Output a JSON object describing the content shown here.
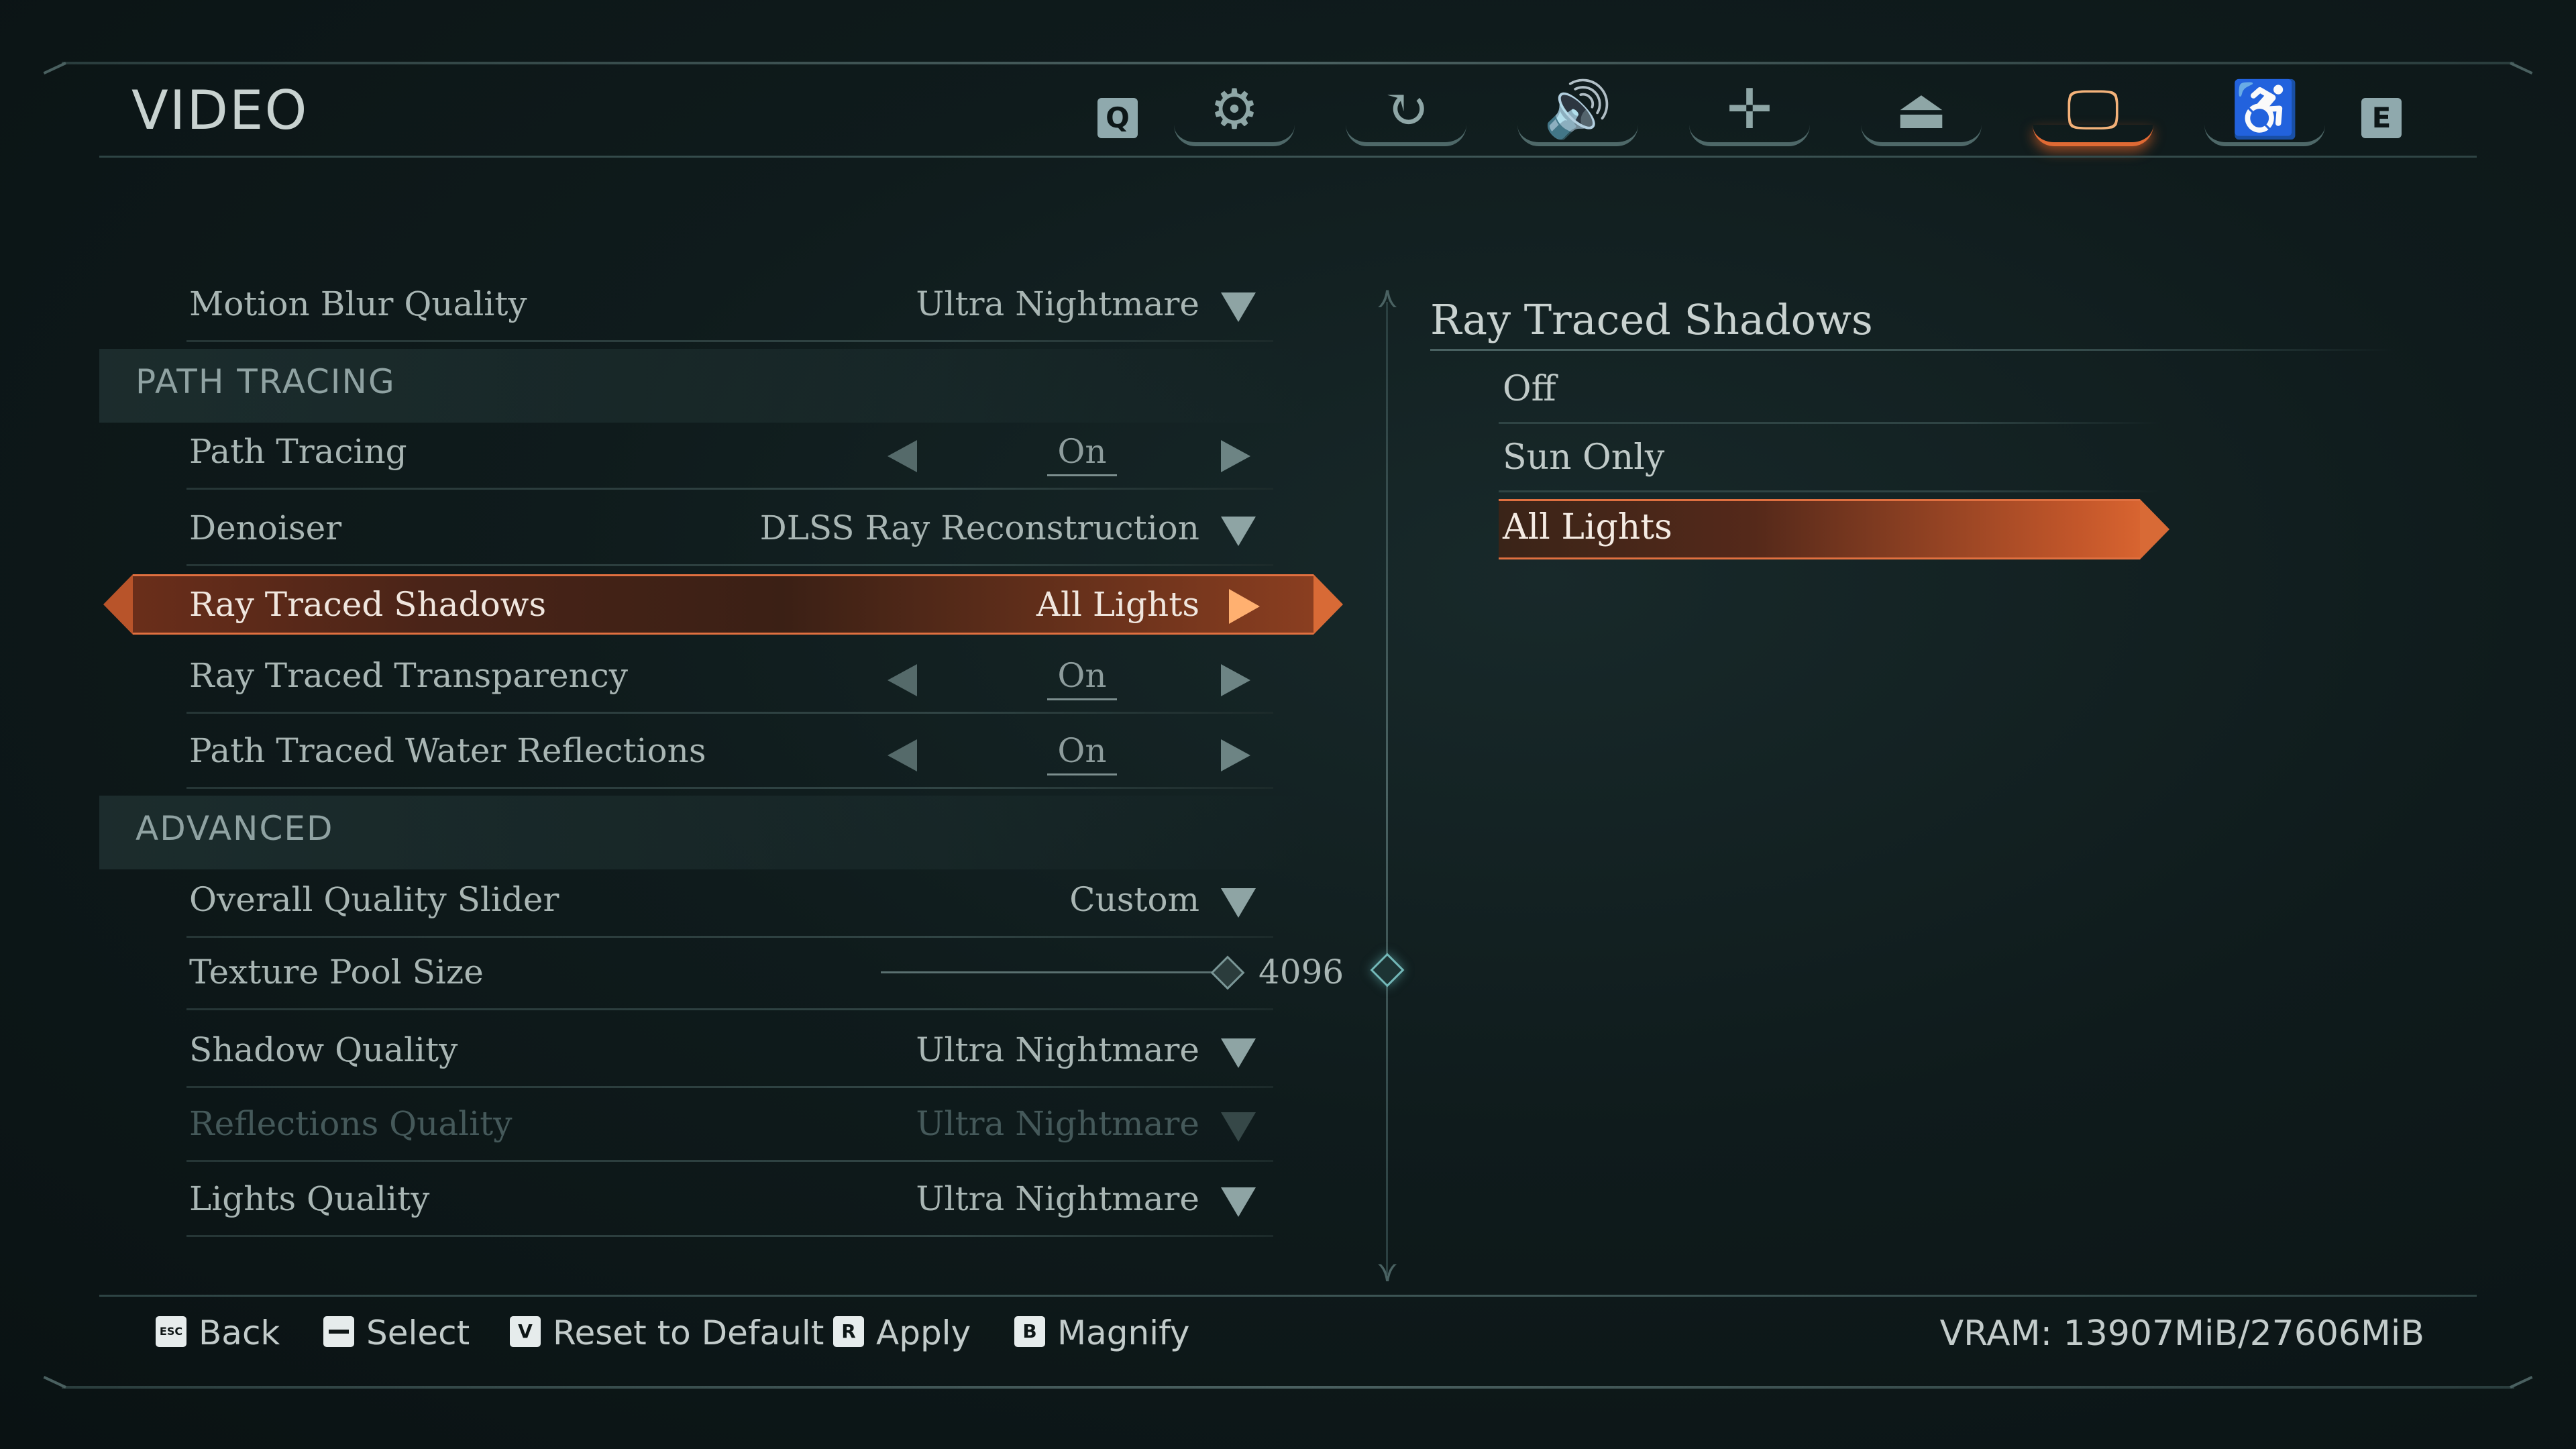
{
  "page": {
    "title": "VIDEO"
  },
  "tabs": {
    "prev_key": "Q",
    "next_key": "E",
    "items": [
      {
        "icon": "gears-icon",
        "glyph": "⚙",
        "active": false
      },
      {
        "icon": "refresh-icon",
        "glyph": "↻",
        "active": false
      },
      {
        "icon": "speaker-icon",
        "glyph": "🔊",
        "active": false
      },
      {
        "icon": "move-icon",
        "glyph": "✛",
        "active": false
      },
      {
        "icon": "joystick-icon",
        "glyph": "⏏",
        "active": false
      },
      {
        "icon": "monitor-icon",
        "glyph": "🖵",
        "active": true
      },
      {
        "icon": "accessibility-icon",
        "glyph": "♿",
        "active": false
      }
    ]
  },
  "settings": {
    "motion_blur": {
      "label": "Motion Blur Quality",
      "value": "Ultra Nightmare"
    },
    "section_path_tracing": "PATH TRACING",
    "path_tracing": {
      "label": "Path Tracing",
      "value": "On"
    },
    "denoiser": {
      "label": "Denoiser",
      "value": "DLSS Ray Reconstruction"
    },
    "ray_traced_shadows": {
      "label": "Ray Traced Shadows",
      "value": "All Lights"
    },
    "ray_traced_transparency": {
      "label": "Ray Traced Transparency",
      "value": "On"
    },
    "path_traced_water": {
      "label": "Path Traced Water Reflections",
      "value": "On"
    },
    "section_advanced": "ADVANCED",
    "overall_quality": {
      "label": "Overall Quality Slider",
      "value": "Custom"
    },
    "texture_pool": {
      "label": "Texture Pool Size",
      "value": "4096"
    },
    "shadow_quality": {
      "label": "Shadow Quality",
      "value": "Ultra Nightmare"
    },
    "reflections_quality": {
      "label": "Reflections Quality",
      "value": "Ultra Nightmare"
    },
    "lights_quality": {
      "label": "Lights Quality",
      "value": "Ultra Nightmare"
    }
  },
  "panel": {
    "title": "Ray Traced Shadows",
    "options": [
      "Off",
      "Sun Only",
      "All Lights"
    ],
    "selected": "All Lights"
  },
  "footer": {
    "hints": [
      {
        "key": "ESC",
        "label": "Back"
      },
      {
        "key": "",
        "label": "Select"
      },
      {
        "key": "V",
        "label": "Reset to Default"
      },
      {
        "key": "R",
        "label": "Apply"
      },
      {
        "key": "B",
        "label": "Magnify"
      }
    ],
    "vram": "VRAM: 13907MiB/27606MiB"
  },
  "colors": {
    "accent": "#e06a34",
    "text": "#b9c4c2",
    "background": "#0f1b1c"
  }
}
